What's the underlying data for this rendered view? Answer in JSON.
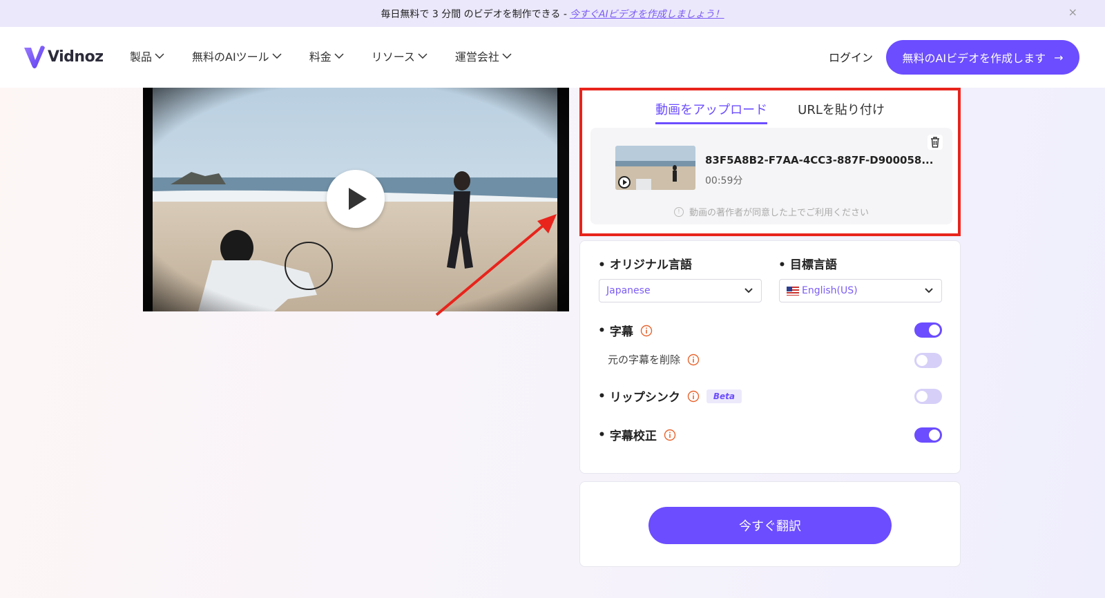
{
  "promo": {
    "text": "毎日無料で 3 分間 のビデオを制作できる -",
    "link": "今すぐAIビデオを作成しましょう！",
    "close": "×"
  },
  "nav": {
    "logo": "Vidnoz",
    "menu": [
      "製品",
      "無料のAIツール",
      "料金",
      "リソース",
      "運営会社"
    ],
    "login": "ログイン",
    "cta": "無料のAIビデオを作成します",
    "cta_arrow": "→"
  },
  "upload": {
    "tabs": [
      "動画をアップロード",
      "URLを貼り付け"
    ],
    "file_name": "83F5A8B2-F7AA-4CC3-887F-D900058...",
    "duration": "00:59分",
    "notice": "動画の著作者が同意した上でご利用ください"
  },
  "settings": {
    "original_language_label": "オリジナル言語",
    "original_language_value": "Japanese",
    "target_language_label": "目標言語",
    "target_language_value": "English(US)",
    "subtitles_label": "字幕",
    "subtitles_on": true,
    "remove_subtitles_label": "元の字幕を削除",
    "remove_subtitles_on": false,
    "lipsync_label": "リップシンク",
    "lipsync_badge": "Beta",
    "lipsync_on": false,
    "proofread_label": "字幕校正",
    "proofread_on": true
  },
  "action": {
    "translate_button": "今すぐ翻訳"
  },
  "colors": {
    "accent": "#6c4dff",
    "highlight_border": "#e8241c",
    "info_icon": "#e8632c"
  }
}
